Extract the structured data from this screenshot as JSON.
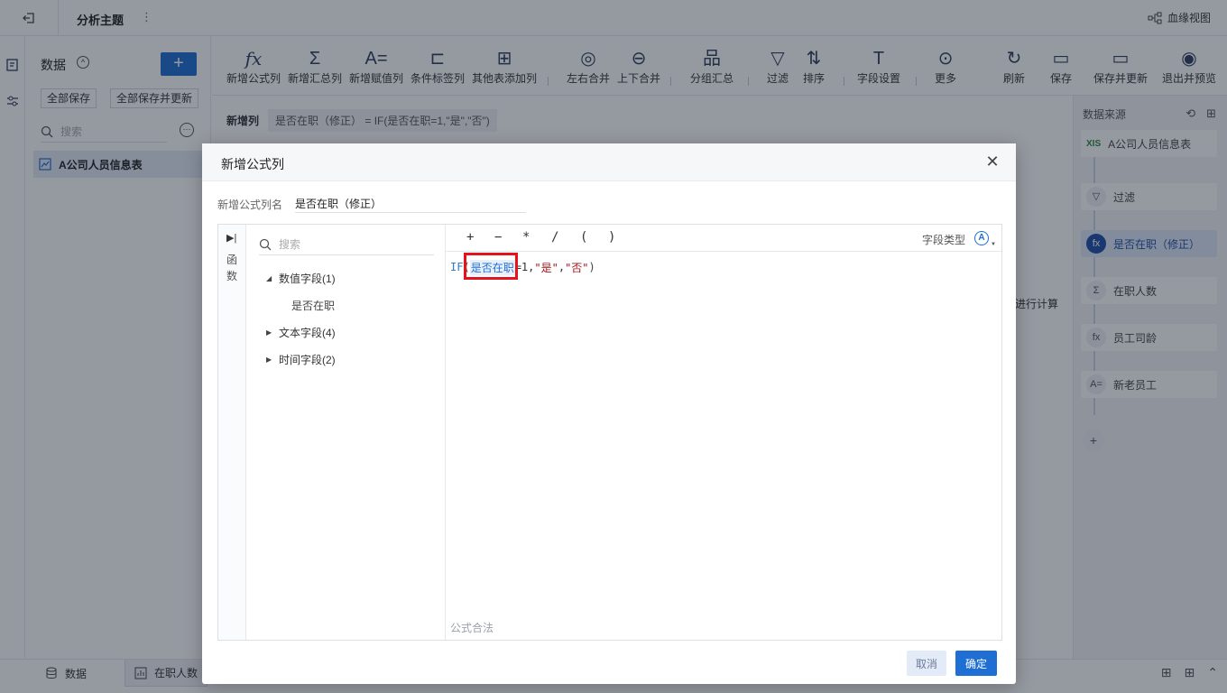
{
  "topbar": {
    "title": "分析主题",
    "more": "⋮",
    "lineage_label": "血缘视图"
  },
  "data_panel": {
    "title": "数据",
    "add": "+",
    "save_all": "全部保存",
    "save_all_update": "全部保存并更新",
    "search_placeholder": "搜索",
    "table_item": "A公司人员信息表"
  },
  "toolbar": {
    "items": [
      {
        "label": "新增公式列",
        "icon": "fx-icon"
      },
      {
        "label": "新增汇总列",
        "icon": "sigma-icon"
      },
      {
        "label": "新增赋值列",
        "icon": "assign-icon"
      },
      {
        "label": "条件标签列",
        "icon": "tag-icon"
      },
      {
        "label": "其他表添加列",
        "icon": "add-column-icon"
      },
      {
        "label": "左右合并",
        "icon": "merge-lr-icon"
      },
      {
        "label": "上下合并",
        "icon": "merge-tb-icon"
      },
      {
        "label": "分组汇总",
        "icon": "group-icon"
      },
      {
        "label": "过滤",
        "icon": "filter-icon"
      },
      {
        "label": "排序",
        "icon": "sort-icon"
      },
      {
        "label": "字段设置",
        "icon": "field-settings-icon"
      },
      {
        "label": "更多",
        "icon": "more-icon"
      },
      {
        "label": "刷新",
        "icon": "refresh-icon"
      },
      {
        "label": "保存",
        "icon": "save-icon"
      },
      {
        "label": "保存并更新",
        "icon": "save-update-icon"
      },
      {
        "label": "退出并预览",
        "icon": "exit-preview-icon"
      }
    ]
  },
  "formula_bar": {
    "label": "新增列",
    "text": "是否在职（修正） = IF(是否在职=1,\"是\",\"否\")"
  },
  "canvas": {
    "calc_text": "进行计算"
  },
  "source_panel": {
    "title": "数据来源",
    "nodes": [
      {
        "label": "A公司人员信息表",
        "icon": "XIS"
      },
      {
        "label": "过滤",
        "icon": "▽"
      },
      {
        "label": "是否在职（修正）",
        "icon": "fx",
        "active": true
      },
      {
        "label": "在职人数",
        "icon": "Σ"
      },
      {
        "label": "员工司龄",
        "icon": "fx"
      },
      {
        "label": "新老员工",
        "icon": "A="
      }
    ],
    "add": "+"
  },
  "bottom": {
    "tab_data": "数据",
    "tab_active": "在职人数"
  },
  "dialog": {
    "title": "新增公式列",
    "name_label": "新增公式列名",
    "name_value": "是否在职（修正）",
    "fn_label": "函数",
    "search_placeholder": "搜索",
    "tree": {
      "numeric": "数值字段(1)",
      "numeric_child": "是否在职",
      "text": "文本字段(4)",
      "time": "时间字段(2)"
    },
    "ops": [
      "+",
      "−",
      "*",
      "/",
      "(",
      ")"
    ],
    "field_type_label": "字段类型",
    "field_type_icon": "A",
    "formula": {
      "fn": "IF",
      "open": "(",
      "field": "是否在职",
      "op": "=1,",
      "str1": "\"是\"",
      "comma": ",",
      "str2": "\"否\"",
      "close": ")"
    },
    "valid_text": "公式合法",
    "cancel": "取消",
    "ok": "确定"
  }
}
